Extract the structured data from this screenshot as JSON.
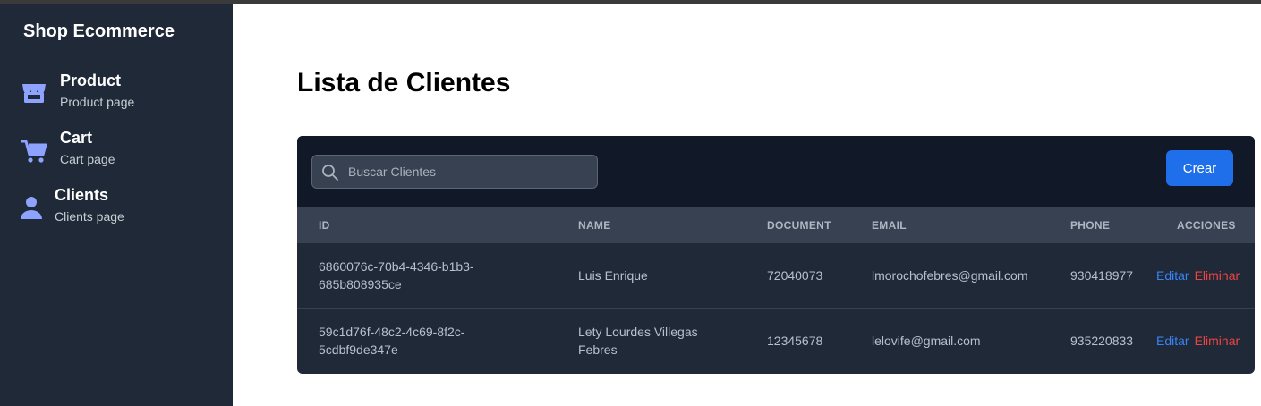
{
  "sidebar": {
    "brand": "Shop Ecommerce",
    "items": [
      {
        "title": "Product",
        "subtitle": "Product page",
        "icon": "store-icon"
      },
      {
        "title": "Cart",
        "subtitle": "Cart page",
        "icon": "cart-icon"
      },
      {
        "title": "Clients",
        "subtitle": "Clients page",
        "icon": "user-icon"
      }
    ]
  },
  "main": {
    "title": "Lista de Clientes",
    "search": {
      "placeholder": "Buscar Clientes",
      "value": ""
    },
    "create_label": "Crear",
    "columns": [
      "ID",
      "NAME",
      "DOCUMENT",
      "EMAIL",
      "PHONE",
      "ACCIONES"
    ],
    "rows": [
      {
        "id_line1": "6860076c-70b4-4346-b1b3-",
        "id_line2": "685b808935ce",
        "name_line1": "Luis Enrique",
        "name_line2": "",
        "document": "72040073",
        "email": "lmorochofebres@gmail.com",
        "phone": "930418977",
        "edit": "Editar",
        "delete": "Eliminar"
      },
      {
        "id_line1": "59c1d76f-48c2-4c69-8f2c-",
        "id_line2": "5cdbf9de347e",
        "name_line1": "Lety Lourdes Villegas",
        "name_line2": "Febres",
        "document": "12345678",
        "email": "lelovife@gmail.com",
        "phone": "935220833",
        "edit": "Editar",
        "delete": "Eliminar"
      }
    ]
  },
  "colors": {
    "sidebar_bg": "#1f2937",
    "card_bg": "#1f2937",
    "card_header_bg": "#111827",
    "icon_accent": "#8ea2ff",
    "primary": "#1f6feb",
    "edit_link": "#3b82f6",
    "delete_link": "#ef4444"
  }
}
